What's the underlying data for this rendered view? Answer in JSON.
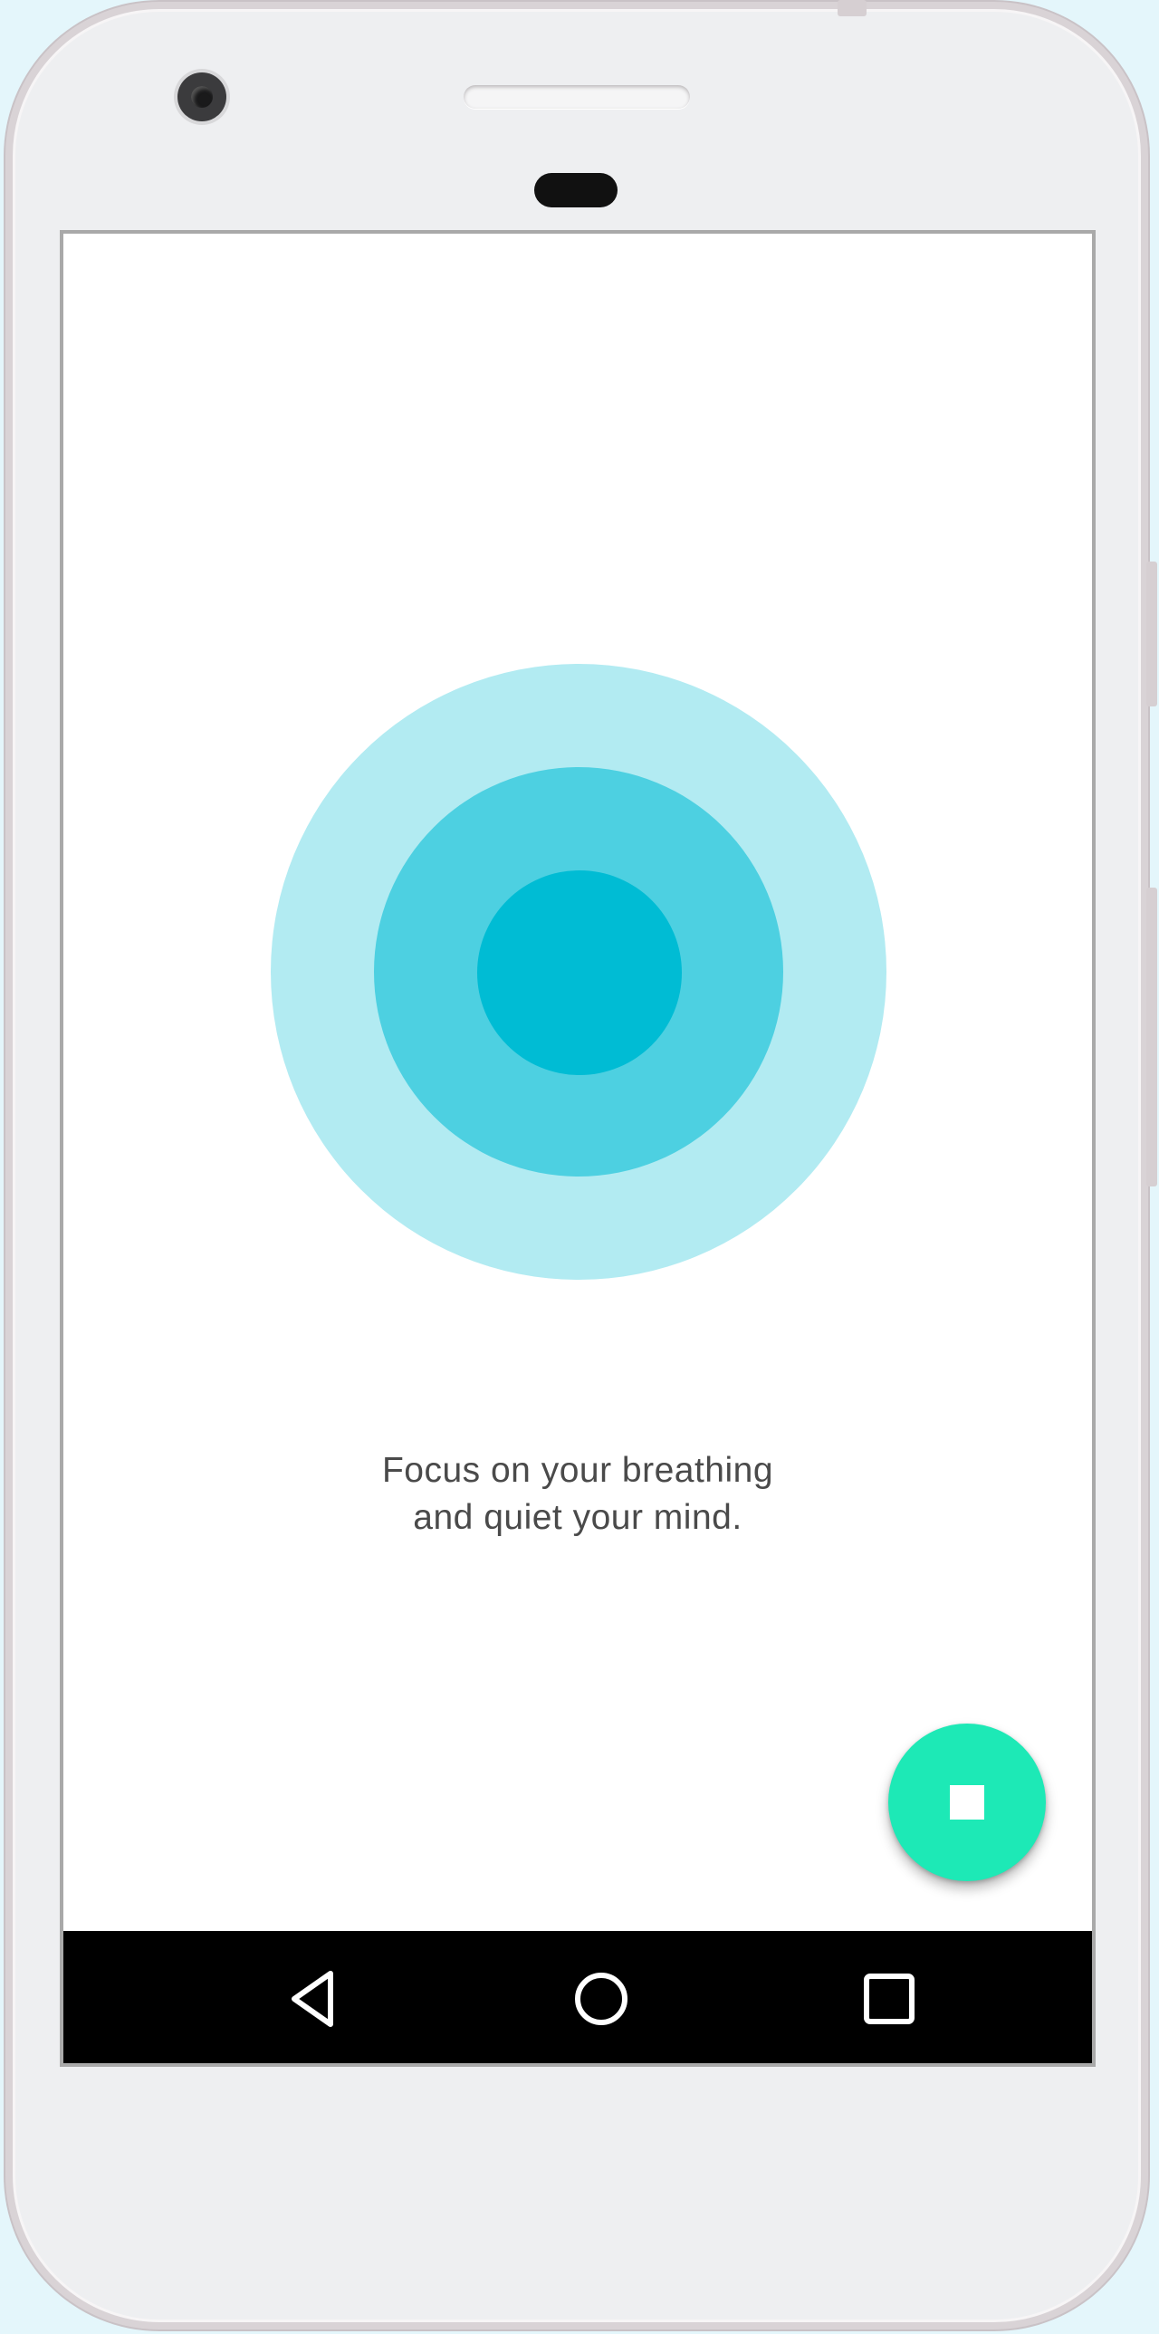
{
  "device": {
    "frame_color": "#eeeff1",
    "background_color": "#e4f6fb"
  },
  "breathing_visual": {
    "outer_color": "#b2ebf2",
    "middle_color": "#4dd0e1",
    "inner_color": "#00bcd4"
  },
  "message": {
    "line1": "Focus on your breathing",
    "line2": "and quiet your mind."
  },
  "stop_button": {
    "icon": "stop-icon",
    "color": "#1de9b6"
  },
  "navigation_bar": {
    "back_icon": "back-triangle-icon",
    "home_icon": "home-circle-icon",
    "recents_icon": "recents-square-icon"
  }
}
